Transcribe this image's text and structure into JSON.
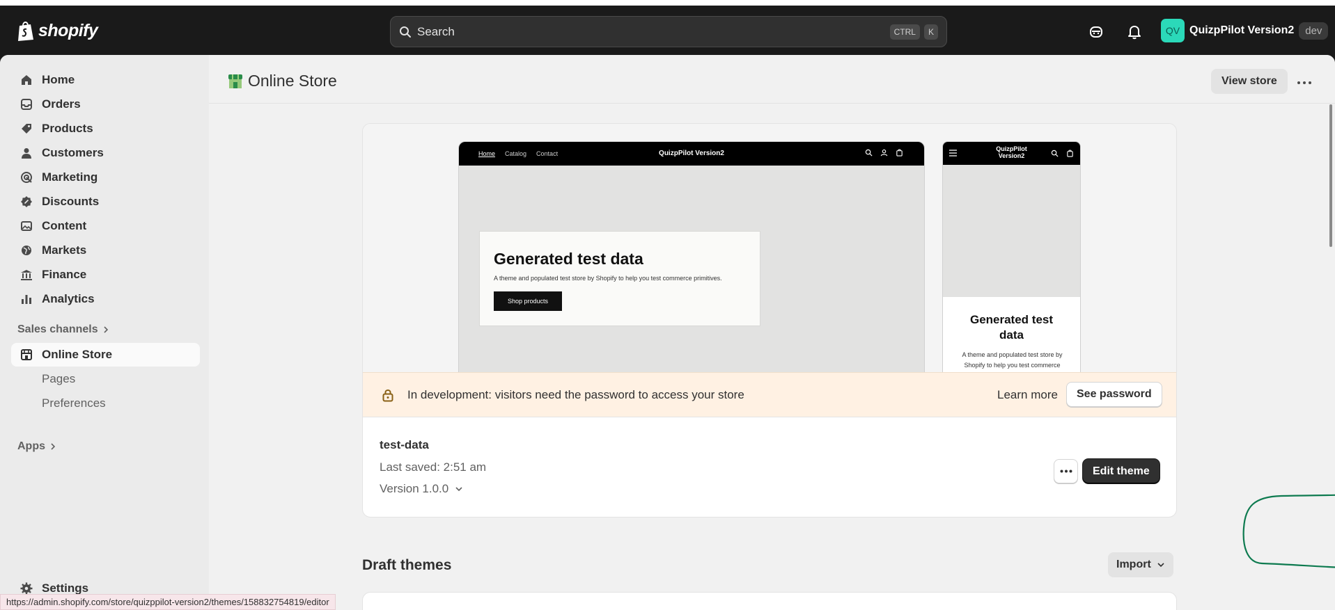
{
  "topbar": {
    "logo_text": "shopify",
    "search_placeholder": "Search",
    "shortcut_keys": [
      "CTRL",
      "K"
    ],
    "store_initials": "QV",
    "store_name": "QuizpPilot Version2",
    "store_badge": "dev",
    "icons": [
      "sidekick-icon",
      "bell-icon"
    ]
  },
  "sidebar": {
    "items": [
      {
        "label": "Home",
        "icon": "home-icon"
      },
      {
        "label": "Orders",
        "icon": "inbox-icon"
      },
      {
        "label": "Products",
        "icon": "tag-icon"
      },
      {
        "label": "Customers",
        "icon": "person-icon"
      },
      {
        "label": "Marketing",
        "icon": "target-icon"
      },
      {
        "label": "Discounts",
        "icon": "discount-icon"
      },
      {
        "label": "Content",
        "icon": "image-icon"
      },
      {
        "label": "Markets",
        "icon": "globe-icon"
      },
      {
        "label": "Finance",
        "icon": "bank-icon"
      },
      {
        "label": "Analytics",
        "icon": "bar-chart-icon"
      }
    ],
    "sales_channels_label": "Sales channels",
    "online_store_label": "Online Store",
    "sub_items": [
      "Pages",
      "Preferences"
    ],
    "apps_label": "Apps",
    "settings_label": "Settings"
  },
  "page": {
    "title": "Online Store",
    "view_store_label": "View store"
  },
  "preview": {
    "desktop_nav": [
      "Home",
      "Catalog",
      "Contact"
    ],
    "store_title": "QuizpPilot Version2",
    "mobile_store_title_line1": "QuizpPilot",
    "mobile_store_title_line2": "Version2",
    "hero_heading": "Generated test data",
    "hero_text": "A theme and populated test store by Shopify to help you test commerce primitives.",
    "hero_button": "Shop products",
    "mobile_heading_line1": "Generated test",
    "mobile_heading_line2": "data",
    "mobile_text": "A theme and populated test store by Shopify to help you test commerce"
  },
  "banner": {
    "message": "In development: visitors need the password to access your store",
    "learn_more": "Learn more",
    "see_password": "See password"
  },
  "theme": {
    "name": "test-data",
    "last_saved": "Last saved: 2:51 am",
    "version": "Version 1.0.0",
    "edit_label": "Edit theme"
  },
  "draft": {
    "title": "Draft themes",
    "import_label": "Import"
  },
  "status_url": "https://admin.shopify.com/store/quizppilot-version2/themes/158832754819/editor",
  "colors": {
    "topbar": "#1a1a1a",
    "accent_avatar": "#2bd9b9",
    "banner_bg": "#fff1e3",
    "annotation": "#0d7a4f"
  }
}
